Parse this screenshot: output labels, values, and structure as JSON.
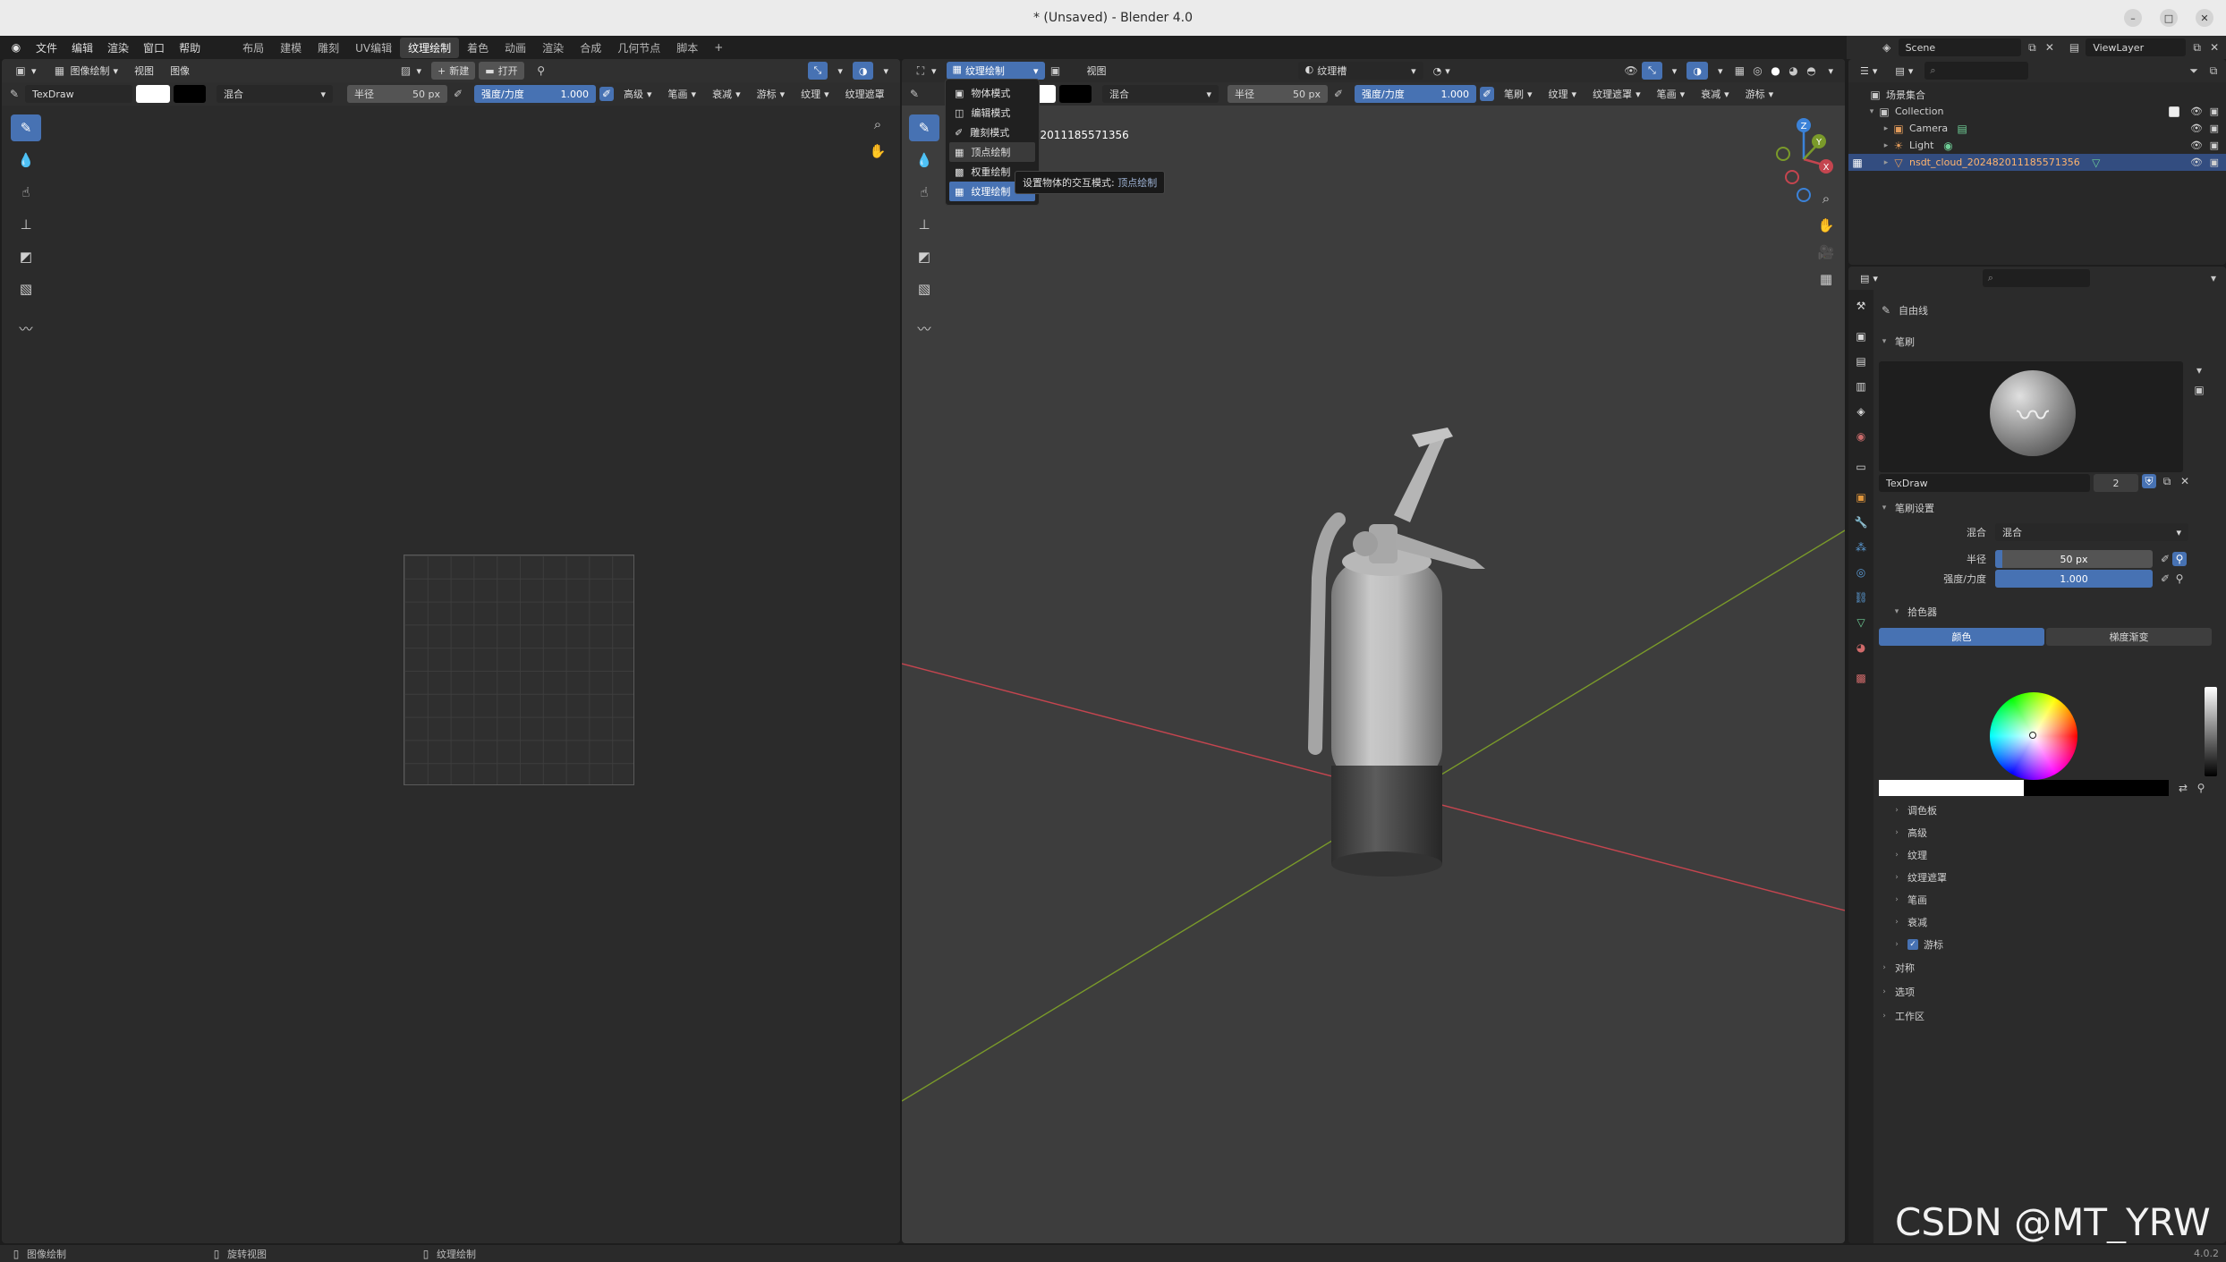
{
  "window": {
    "title": "* (Unsaved) - Blender 4.0",
    "min": "–",
    "max": "□",
    "close": "✕"
  },
  "menu": {
    "items": [
      "文件",
      "编辑",
      "渲染",
      "窗口",
      "帮助"
    ],
    "workspaces": [
      "布局",
      "建模",
      "雕刻",
      "UV编辑",
      "纹理绘制",
      "着色",
      "动画",
      "渲染",
      "合成",
      "几何节点",
      "脚本"
    ],
    "active_workspace": "纹理绘制",
    "add": "+"
  },
  "image_editor": {
    "mode": "图像绘制",
    "view": "视图",
    "image": "图像",
    "new": "新建",
    "open": "打开",
    "brush_name": "TexDraw",
    "blend": "混合",
    "radius_label": "半径",
    "radius_value": "50 px",
    "strength_label": "强度/力度",
    "strength_value": "1.000",
    "strength_fraction": 1.0,
    "extras": [
      "高级",
      "笔画",
      "衰减",
      "游标",
      "纹理",
      "纹理遮罩"
    ]
  },
  "viewport": {
    "mode": "纹理绘制",
    "view": "视图",
    "slot": "纹理槽",
    "blend": "混合",
    "radius_label": "半径",
    "radius_value": "50 px",
    "strength_label": "强度/力度",
    "strength_value": "1.000",
    "strength_fraction": 1.0,
    "extras": [
      "笔刷",
      "纹理",
      "纹理遮罩",
      "笔画",
      "衰减",
      "游标"
    ],
    "object_label_partial": "02482011185571356",
    "gizmo": {
      "x": "X",
      "y": "Y",
      "z": "Z"
    }
  },
  "mode_menu": {
    "items": [
      "物体模式",
      "编辑模式",
      "雕刻模式",
      "顶点绘制",
      "权重绘制",
      "纹理绘制"
    ],
    "hovered": "顶点绘制",
    "selected": "纹理绘制",
    "tooltip_prefix": "设置物体的交互模式:",
    "tooltip_value": "顶点绘制"
  },
  "outliner": {
    "scene": "Scene",
    "viewlayer": "ViewLayer",
    "root": "场景集合",
    "collection": "Collection",
    "items": [
      "Camera",
      "Light",
      "nsdt_cloud_202482011185571356"
    ]
  },
  "properties": {
    "tool_name": "自由线",
    "brushes_panel": "笔刷",
    "brush_name": "TexDraw",
    "brush_users": "2",
    "brush_settings_panel": "笔刷设置",
    "blend_label": "混合",
    "blend_value": "混合",
    "radius_label": "半径",
    "radius_value": "50 px",
    "strength_label": "强度/力度",
    "strength_value": "1.000",
    "strength_fraction": 1.0,
    "color_picker_panel": "拾色器",
    "tab_color": "颜色",
    "tab_gradient": "梯度渐变",
    "subpanels": [
      "调色板",
      "高级",
      "纹理",
      "纹理遮罩",
      "笔画",
      "衰减",
      "游标"
    ],
    "cursor_checked": true,
    "top_panels": [
      "对称",
      "选项",
      "工作区"
    ]
  },
  "status": {
    "left": "图像绘制",
    "middle": "旋转视图",
    "right": "纹理绘制",
    "version": "4.0.2"
  },
  "watermark": "CSDN @MT_YRW",
  "colors": {
    "accent": "#4772b3",
    "x_axis": "#c4454f",
    "y_axis": "#7a9a2a",
    "z_axis": "#3b82d8"
  }
}
